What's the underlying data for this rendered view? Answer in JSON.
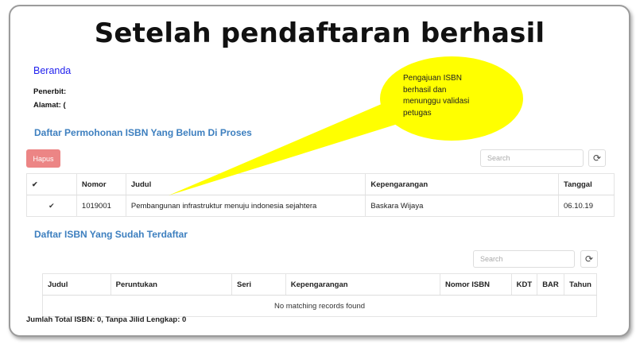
{
  "headline": "Setelah pendaftaran berhasil",
  "beranda": "Beranda",
  "penerbit_label": "Penerbit:",
  "alamat_label": "Alamat: (",
  "section1": {
    "title": "Daftar Permohonan ISBN Yang Belum Di Proses",
    "delete_label": "Hapus",
    "search_placeholder": "Search",
    "columns": [
      "✔",
      "Nomor",
      "Judul",
      "Kepengarangan",
      "Tanggal"
    ],
    "rows": [
      {
        "check": "✔",
        "nomor": "1019001",
        "judul": "Pembangunan infrastruktur menuju indonesia sejahtera",
        "kepengarangan": "Baskara Wijaya",
        "tanggal": "06.10.19"
      }
    ]
  },
  "section2": {
    "title": "Daftar ISBN Yang Sudah Terdaftar",
    "search_placeholder": "Search",
    "columns": [
      "Judul",
      "Peruntukan",
      "Seri",
      "Kepengarangan",
      "Nomor ISBN",
      "KDT",
      "BAR",
      "Tahun"
    ],
    "empty_text": "No matching records found"
  },
  "footer": "Jumlah Total ISBN: 0, Tanpa Jilid Lengkap: 0",
  "callout": {
    "line1": "Pengajuan ISBN",
    "line2": "berhasil dan",
    "line3": "menunggu validasi",
    "line4": "petugas",
    "fill": "#ffff00",
    "text_color": "#222222"
  },
  "colors": {
    "link": "#2222ee",
    "section_title": "#3d7fbf",
    "delete_button": "#ec8585"
  },
  "icons": {
    "refresh": "refresh-icon",
    "check": "check-icon"
  }
}
